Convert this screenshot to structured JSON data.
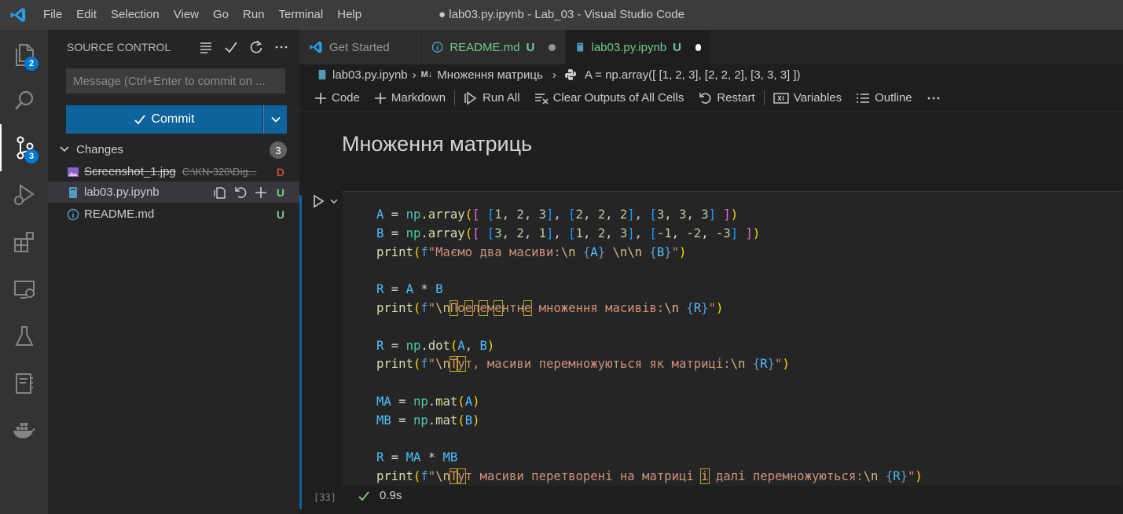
{
  "titlebar": {
    "menus": [
      "File",
      "Edit",
      "Selection",
      "View",
      "Go",
      "Run",
      "Terminal",
      "Help"
    ],
    "window_title": "● lab03.py.ipynb - Lab_03 - Visual Studio Code"
  },
  "activitybar": {
    "explorer_badge": "2",
    "scm_badge": "3"
  },
  "sidebar": {
    "title": "SOURCE CONTROL",
    "message_placeholder": "Message (Ctrl+Enter to commit on ...",
    "commit_label": "Commit",
    "changes_label": "Changes",
    "changes_count": "3",
    "files": [
      {
        "name": "Screenshot_1.jpg",
        "path": "C:\\KN-320\\Dig...",
        "status": "D"
      },
      {
        "name": "lab03.py.ipynb",
        "path": "",
        "status": "U"
      },
      {
        "name": "README.md",
        "path": "",
        "status": "U"
      }
    ]
  },
  "tabs": [
    {
      "label": "Get Started",
      "status": ""
    },
    {
      "label": "README.md",
      "status": "U"
    },
    {
      "label": "lab03.py.ipynb",
      "status": "U"
    }
  ],
  "breadcrumb": {
    "file": "lab03.py.ipynb",
    "md_prefix": "M↓",
    "section": "Множення матриць",
    "cell": "A = np.array([ [1, 2, 3], [2, 2, 2], [3, 3, 3] ])"
  },
  "toolbar": {
    "code": "Code",
    "markdown": "Markdown",
    "run_all": "Run All",
    "clear_outputs": "Clear Outputs of All Cells",
    "restart": "Restart",
    "variables": "Variables",
    "outline": "Outline"
  },
  "notebook": {
    "heading": "Множення матриць",
    "exec_count": "[33]",
    "exec_time": "0.9s"
  },
  "colors": {
    "accent": "#0e639c",
    "untracked": "#73c991",
    "deleted": "#c74e39"
  }
}
